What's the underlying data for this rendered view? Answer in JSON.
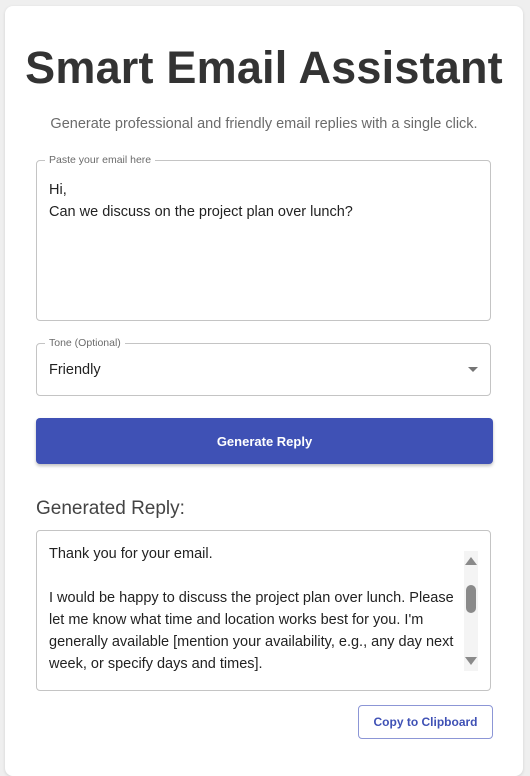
{
  "header": {
    "title": "Smart Email Assistant",
    "subtitle": "Generate professional and friendly email replies with a single click."
  },
  "email_input": {
    "label": "Paste your email here",
    "value": "Hi,\nCan we discuss on the project plan over lunch?"
  },
  "tone_select": {
    "label": "Tone (Optional)",
    "selected": "Friendly"
  },
  "generate_button": {
    "label": "Generate Reply"
  },
  "reply": {
    "heading": "Generated Reply:",
    "text": "Thank you for your email.\n\nI would be happy to discuss the project plan over lunch. Please let me know what time and location works best for you. I'm generally available [mention your availability, e.g., any day next week, or specify days and times]."
  },
  "copy_button": {
    "label": "Copy to Clipboard"
  },
  "colors": {
    "primary": "#3f51b5",
    "background": "#efefef",
    "card": "#ffffff"
  }
}
